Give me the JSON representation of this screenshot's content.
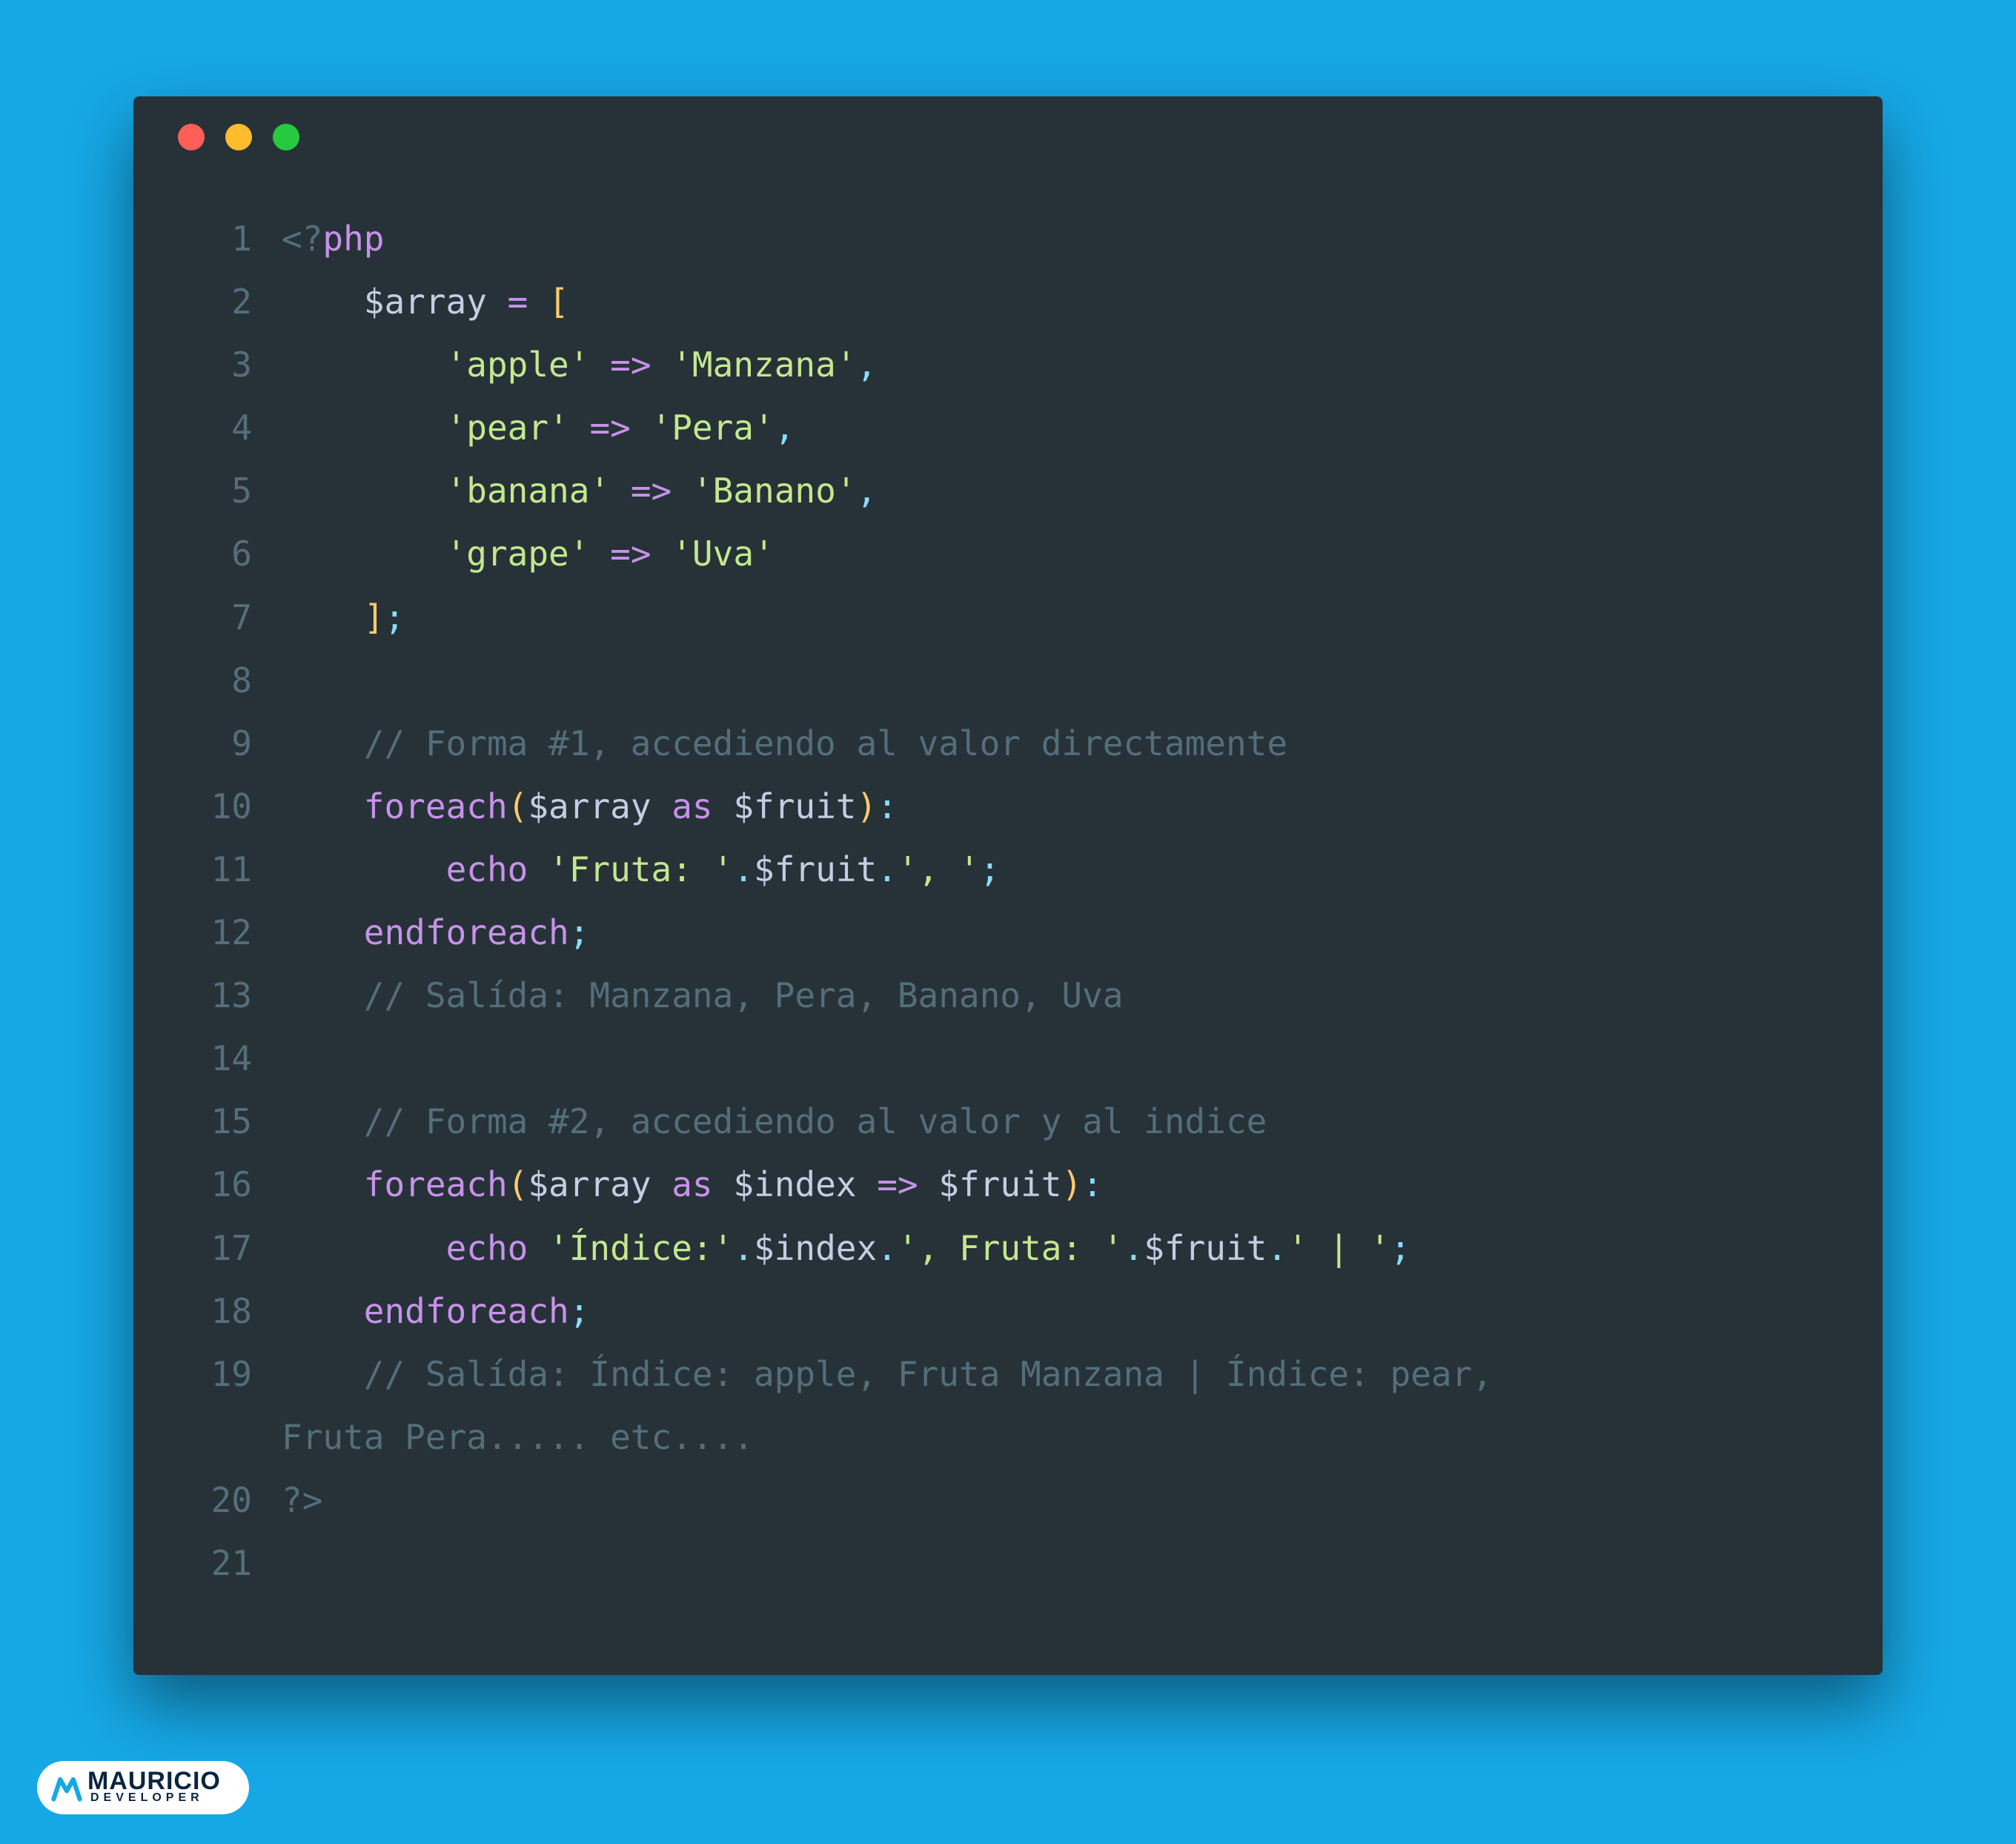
{
  "colors": {
    "background": "#16a8e6",
    "editor_bg": "#263238",
    "gutter": "#546e7a",
    "default": "#c3cee3",
    "keyword": "#c792ea",
    "func": "#82aaff",
    "string": "#c3e88d",
    "yellow": "#ffcb6b",
    "operator": "#89ddff",
    "orange": "#f78c6c",
    "dot_red": "#ff5f56",
    "dot_yellow": "#ffbd2e",
    "dot_green": "#27c93f"
  },
  "badge": {
    "line1": "MAURICIO",
    "line2": "DEVELOPER"
  },
  "code": {
    "language": "php",
    "raw": "<?php\n    $array = [\n        'apple' => 'Manzana',\n        'pear' => 'Pera',\n        'banana' => 'Banano',\n        'grape' => 'Uva'\n    ];\n\n    // Forma #1, accediendo al valor directamente\n    foreach($array as $fruit):\n        echo 'Fruta: '.$fruit.', ';\n    endforeach;\n    // Salída: Manzana, Pera, Banano, Uva\n\n    // Forma #2, accediendo al valor y al indice\n    foreach($array as $index => $fruit):\n        echo 'Índice:'.$index.', Fruta: '.$fruit.' | ';\n    endforeach;\n    // Salída: Índice: apple, Fruta Manzana | Índice: pear, Fruta Pera..... etc....\n?>\n",
    "lines": [
      {
        "n": "1",
        "tokens": [
          [
            "c-dim",
            "<?"
          ],
          [
            "c-kw",
            "php"
          ]
        ]
      },
      {
        "n": "2",
        "tokens": [
          [
            "c-default",
            "    $array "
          ],
          [
            "c-kw",
            "="
          ],
          [
            "c-default",
            " "
          ],
          [
            "c-yellow",
            "["
          ]
        ]
      },
      {
        "n": "3",
        "tokens": [
          [
            "c-default",
            "        "
          ],
          [
            "c-green",
            "'apple'"
          ],
          [
            "c-default",
            " "
          ],
          [
            "c-kw",
            "=>"
          ],
          [
            "c-default",
            " "
          ],
          [
            "c-green",
            "'Manzana'"
          ],
          [
            "c-op",
            ","
          ]
        ]
      },
      {
        "n": "4",
        "tokens": [
          [
            "c-default",
            "        "
          ],
          [
            "c-green",
            "'pear'"
          ],
          [
            "c-default",
            " "
          ],
          [
            "c-kw",
            "=>"
          ],
          [
            "c-default",
            " "
          ],
          [
            "c-green",
            "'Pera'"
          ],
          [
            "c-op",
            ","
          ]
        ]
      },
      {
        "n": "5",
        "tokens": [
          [
            "c-default",
            "        "
          ],
          [
            "c-green",
            "'banana'"
          ],
          [
            "c-default",
            " "
          ],
          [
            "c-kw",
            "=>"
          ],
          [
            "c-default",
            " "
          ],
          [
            "c-green",
            "'Banano'"
          ],
          [
            "c-op",
            ","
          ]
        ]
      },
      {
        "n": "6",
        "tokens": [
          [
            "c-default",
            "        "
          ],
          [
            "c-green",
            "'grape'"
          ],
          [
            "c-default",
            " "
          ],
          [
            "c-kw",
            "=>"
          ],
          [
            "c-default",
            " "
          ],
          [
            "c-green",
            "'Uva'"
          ]
        ]
      },
      {
        "n": "7",
        "tokens": [
          [
            "c-default",
            "    "
          ],
          [
            "c-yellow",
            "]"
          ],
          [
            "c-op",
            ";"
          ]
        ]
      },
      {
        "n": "8",
        "tokens": [
          [
            "c-default",
            ""
          ]
        ]
      },
      {
        "n": "9",
        "tokens": [
          [
            "c-default",
            "    "
          ],
          [
            "c-dim",
            "// Forma #1, accediendo al valor directamente"
          ]
        ]
      },
      {
        "n": "10",
        "tokens": [
          [
            "c-default",
            "    "
          ],
          [
            "c-kw",
            "foreach"
          ],
          [
            "c-yellow",
            "("
          ],
          [
            "c-default",
            "$array "
          ],
          [
            "c-kw",
            "as"
          ],
          [
            "c-default",
            " $fruit"
          ],
          [
            "c-yellow",
            ")"
          ],
          [
            "c-op",
            ":"
          ]
        ]
      },
      {
        "n": "11",
        "tokens": [
          [
            "c-default",
            "        "
          ],
          [
            "c-kw",
            "echo"
          ],
          [
            "c-default",
            " "
          ],
          [
            "c-green",
            "'Fruta: '"
          ],
          [
            "c-op",
            "."
          ],
          [
            "c-default",
            "$fruit"
          ],
          [
            "c-op",
            "."
          ],
          [
            "c-green",
            "', '"
          ],
          [
            "c-op",
            ";"
          ]
        ]
      },
      {
        "n": "12",
        "tokens": [
          [
            "c-default",
            "    "
          ],
          [
            "c-kw",
            "endforeach"
          ],
          [
            "c-op",
            ";"
          ]
        ]
      },
      {
        "n": "13",
        "tokens": [
          [
            "c-default",
            "    "
          ],
          [
            "c-dim",
            "// Salída: Manzana, Pera, Banano, Uva"
          ]
        ]
      },
      {
        "n": "14",
        "tokens": [
          [
            "c-default",
            ""
          ]
        ]
      },
      {
        "n": "15",
        "tokens": [
          [
            "c-default",
            "    "
          ],
          [
            "c-dim",
            "// Forma #2, accediendo al valor y al indice"
          ]
        ]
      },
      {
        "n": "16",
        "tokens": [
          [
            "c-default",
            "    "
          ],
          [
            "c-kw",
            "foreach"
          ],
          [
            "c-yellow",
            "("
          ],
          [
            "c-default",
            "$array "
          ],
          [
            "c-kw",
            "as"
          ],
          [
            "c-default",
            " $index "
          ],
          [
            "c-kw",
            "=>"
          ],
          [
            "c-default",
            " $fruit"
          ],
          [
            "c-yellow",
            ")"
          ],
          [
            "c-op",
            ":"
          ]
        ]
      },
      {
        "n": "17",
        "tokens": [
          [
            "c-default",
            "        "
          ],
          [
            "c-kw",
            "echo"
          ],
          [
            "c-default",
            " "
          ],
          [
            "c-green",
            "'Índice:'"
          ],
          [
            "c-op",
            "."
          ],
          [
            "c-default",
            "$index"
          ],
          [
            "c-op",
            "."
          ],
          [
            "c-green",
            "', Fruta: '"
          ],
          [
            "c-op",
            "."
          ],
          [
            "c-default",
            "$fruit"
          ],
          [
            "c-op",
            "."
          ],
          [
            "c-green",
            "' | '"
          ],
          [
            "c-op",
            ";"
          ]
        ]
      },
      {
        "n": "18",
        "tokens": [
          [
            "c-default",
            "    "
          ],
          [
            "c-kw",
            "endforeach"
          ],
          [
            "c-op",
            ";"
          ]
        ]
      },
      {
        "n": "19",
        "tokens": [
          [
            "c-default",
            "    "
          ],
          [
            "c-dim",
            "// Salída: Índice: apple, Fruta Manzana | Índice: pear, "
          ]
        ]
      },
      {
        "n": "",
        "wrap": true,
        "tokens": [
          [
            "c-dim",
            "Fruta Pera..... etc...."
          ]
        ]
      },
      {
        "n": "20",
        "tokens": [
          [
            "c-dim",
            "?>"
          ]
        ]
      },
      {
        "n": "21",
        "tokens": [
          [
            "c-default",
            ""
          ]
        ]
      }
    ]
  }
}
